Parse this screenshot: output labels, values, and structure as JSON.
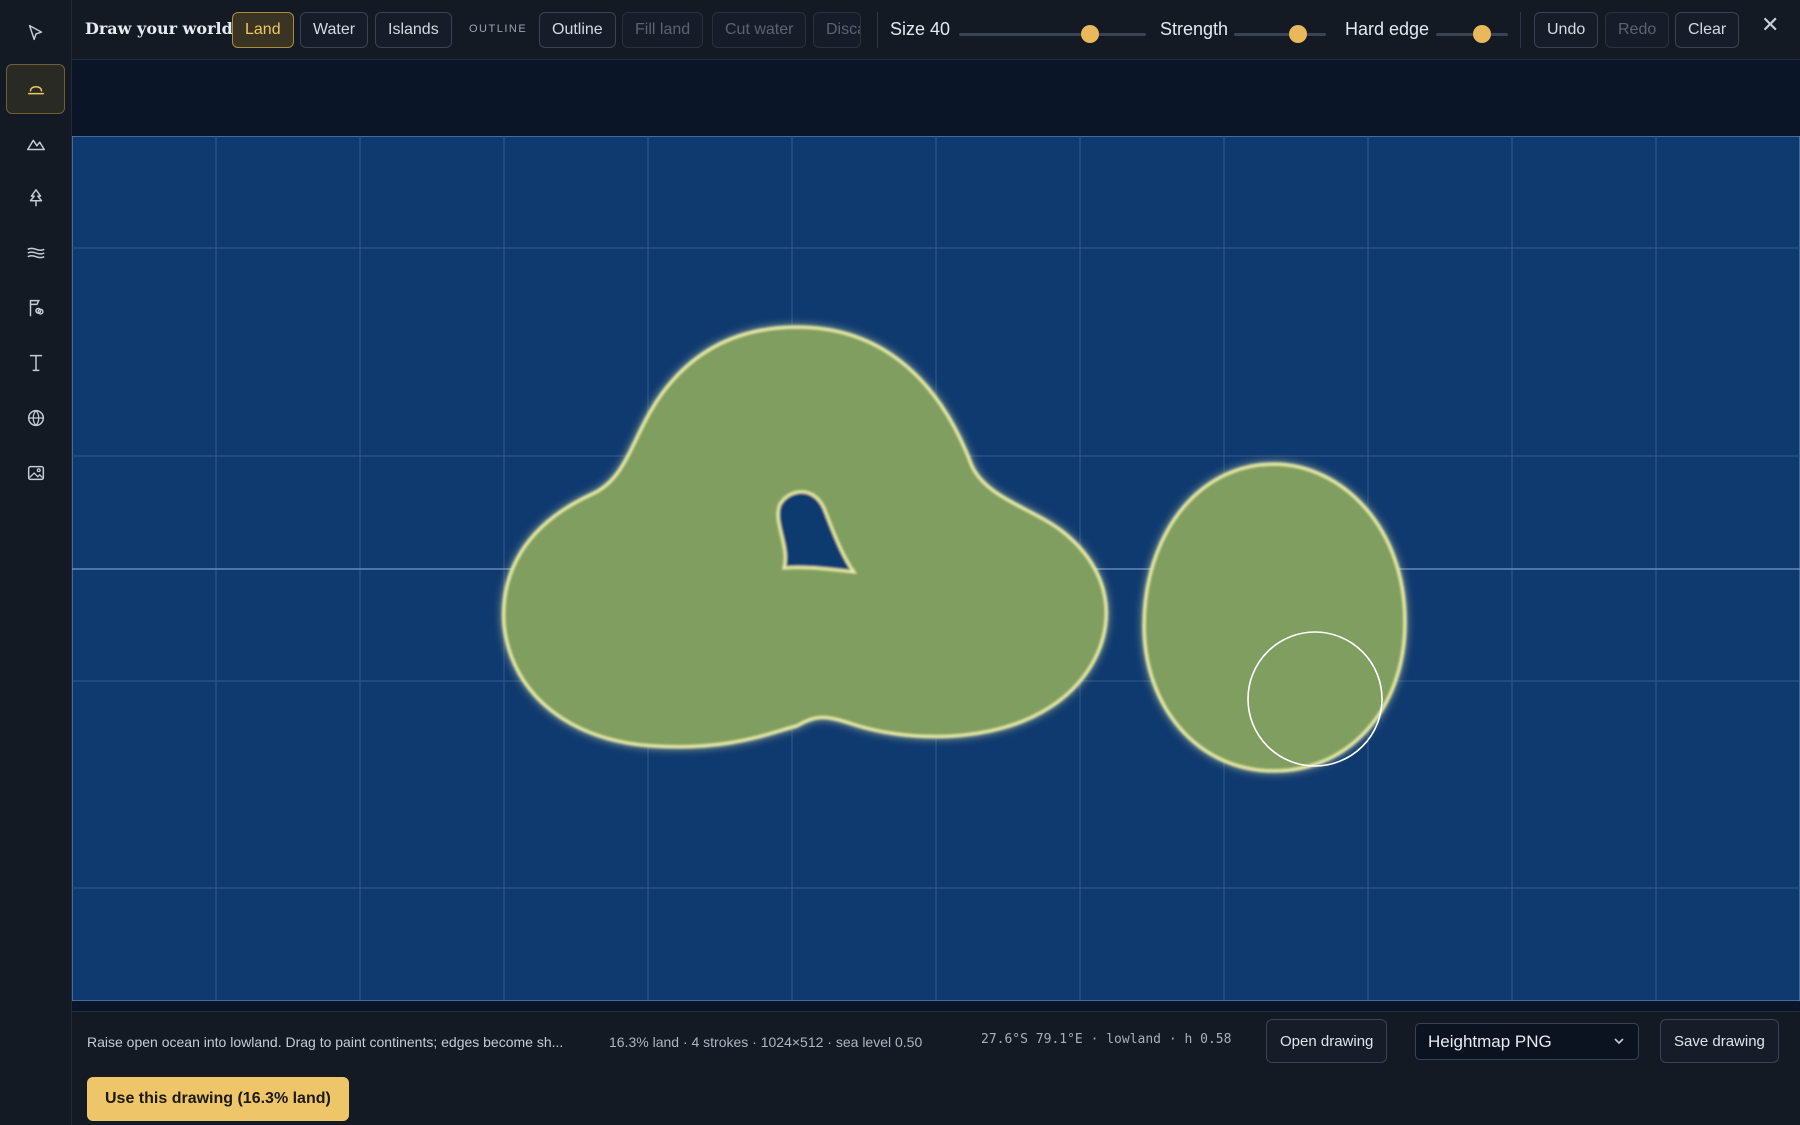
{
  "toolbar": {
    "title": "Draw your world",
    "mode_land": "Land",
    "mode_water": "Water",
    "mode_islands": "Islands",
    "outline_label": "OUTLINE",
    "outline": "Outline",
    "fill_land": "Fill land",
    "cut_water": "Cut water",
    "discard": "Disca",
    "size_label": "Size 40",
    "strength_label": "Strength",
    "hard_edge_label": "Hard edge",
    "undo": "Undo",
    "redo": "Redo",
    "clear": "Clear",
    "close": "✕"
  },
  "sliders": {
    "size": 0.7,
    "strength": 0.7,
    "hard_edge": 0.64
  },
  "rail": {
    "icons": [
      "pointer-icon",
      "land-brush-icon",
      "mountain-icon",
      "tree-icon",
      "water-waves-icon",
      "flag-icon",
      "text-icon",
      "globe-icon",
      "image-icon"
    ],
    "active": "land-brush-icon"
  },
  "status": {
    "hint": "Raise open ocean into lowland. Drag to paint continents; edges become sh...",
    "stats": "16.3% land · 4 strokes · 1024×512 · sea level 0.50",
    "coords": "27.6°S 79.1°E · lowland · h 0.58",
    "open_drawing": "Open drawing",
    "export_format": "Heightmap PNG",
    "save_drawing": "Save drawing",
    "use_drawing": "Use this drawing (16.3% land)"
  },
  "colors": {
    "accent": "#efc56a",
    "ocean": "#0f3a70",
    "land": "#7f9e5f",
    "land_edge": "#f3f2a0"
  }
}
